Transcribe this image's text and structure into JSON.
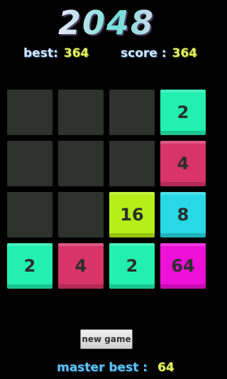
{
  "title": "2048",
  "best": {
    "label": "best:",
    "value": "364"
  },
  "score": {
    "label": "score :",
    "value": "364"
  },
  "colors": {
    "empty": "#2d322d",
    "tile_2": "#22f0b0",
    "tile_4": "#d8346a",
    "tile_8": "#28d8e6",
    "tile_16": "#b6ee18",
    "tile_64": "#ee10d8"
  },
  "board": [
    [
      "",
      "",
      "",
      "2"
    ],
    [
      "",
      "",
      "",
      "4"
    ],
    [
      "",
      "",
      "16",
      "8"
    ],
    [
      "2",
      "4",
      "2",
      "64"
    ]
  ],
  "new_game_label": "new game",
  "master_best": {
    "label": "master best :",
    "value": "64"
  }
}
